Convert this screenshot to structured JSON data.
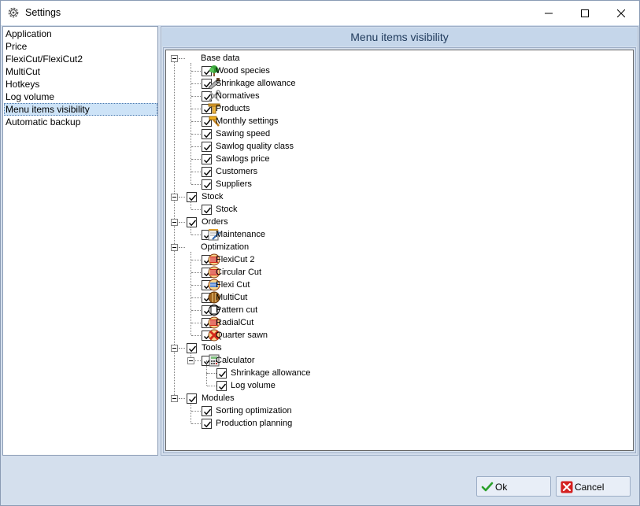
{
  "window": {
    "title": "Settings"
  },
  "nav": {
    "items": [
      {
        "label": "Application",
        "selected": false
      },
      {
        "label": "Price",
        "selected": false
      },
      {
        "label": "FlexiCut/FlexiCut2",
        "selected": false
      },
      {
        "label": "MultiCut",
        "selected": false
      },
      {
        "label": "Hotkeys",
        "selected": false
      },
      {
        "label": "Log volume",
        "selected": false
      },
      {
        "label": "Menu items visibility",
        "selected": true
      },
      {
        "label": "Automatic backup",
        "selected": false
      }
    ]
  },
  "panel": {
    "title": "Menu items visibility",
    "tree": [
      {
        "label": "Base data",
        "level": 0,
        "checkbox": false,
        "expandable": true,
        "icon": ""
      },
      {
        "label": "Wood species",
        "level": 1,
        "checkbox": true,
        "checked": true,
        "icon": "tree-icon"
      },
      {
        "label": "Shrinkage allowance",
        "level": 1,
        "checkbox": true,
        "checked": true,
        "icon": "saw-icon"
      },
      {
        "label": "Normatives",
        "level": 1,
        "checkbox": true,
        "checked": true,
        "icon": "tools-icon"
      },
      {
        "label": "Products",
        "level": 1,
        "checkbox": true,
        "checked": true,
        "icon": "beam-icon"
      },
      {
        "label": "Monthly settings",
        "level": 1,
        "checkbox": true,
        "checked": true,
        "icon": "hammer-icon"
      },
      {
        "label": "Sawing speed",
        "level": 1,
        "checkbox": true,
        "checked": true,
        "icon": ""
      },
      {
        "label": "Sawlog quality class",
        "level": 1,
        "checkbox": true,
        "checked": true,
        "icon": ""
      },
      {
        "label": "Sawlogs price",
        "level": 1,
        "checkbox": true,
        "checked": true,
        "icon": ""
      },
      {
        "label": "Customers",
        "level": 1,
        "checkbox": true,
        "checked": true,
        "icon": ""
      },
      {
        "label": "Suppliers",
        "level": 1,
        "checkbox": true,
        "checked": true,
        "icon": ""
      },
      {
        "label": "Stock",
        "level": 0,
        "checkbox": true,
        "checked": true,
        "expandable": true,
        "icon": ""
      },
      {
        "label": "Stock",
        "level": 1,
        "checkbox": true,
        "checked": true,
        "icon": ""
      },
      {
        "label": "Orders",
        "level": 0,
        "checkbox": true,
        "checked": true,
        "expandable": true,
        "icon": ""
      },
      {
        "label": "Maintenance",
        "level": 1,
        "checkbox": true,
        "checked": true,
        "icon": "maintenance-icon"
      },
      {
        "label": "Optimization",
        "level": 0,
        "checkbox": false,
        "expandable": true,
        "icon": ""
      },
      {
        "label": "FlexiCut 2",
        "level": 1,
        "checkbox": true,
        "checked": true,
        "icon": "log-red-icon"
      },
      {
        "label": "Circular Cut",
        "level": 1,
        "checkbox": true,
        "checked": true,
        "icon": "log-red-icon"
      },
      {
        "label": "Flexi Cut",
        "level": 1,
        "checkbox": true,
        "checked": true,
        "icon": "log-blue-icon"
      },
      {
        "label": "MultiCut",
        "level": 1,
        "checkbox": true,
        "checked": true,
        "icon": "log-brown-icon"
      },
      {
        "label": "Pattern cut",
        "level": 1,
        "checkbox": true,
        "checked": true,
        "icon": "log-outline-icon"
      },
      {
        "label": "RadialCut",
        "level": 1,
        "checkbox": true,
        "checked": true,
        "icon": "log-red-icon"
      },
      {
        "label": "Quarter sawn",
        "level": 1,
        "checkbox": true,
        "checked": true,
        "icon": "log-cross-icon"
      },
      {
        "label": "Tools",
        "level": 0,
        "checkbox": true,
        "checked": true,
        "expandable": true,
        "icon": ""
      },
      {
        "label": "Calculator",
        "level": 1,
        "checkbox": true,
        "checked": true,
        "expandable": true,
        "icon": "calculator-icon"
      },
      {
        "label": "Shrinkage allowance",
        "level": 2,
        "checkbox": true,
        "checked": true,
        "icon": ""
      },
      {
        "label": "Log volume",
        "level": 2,
        "checkbox": true,
        "checked": true,
        "icon": ""
      },
      {
        "label": "Modules",
        "level": 0,
        "checkbox": true,
        "checked": true,
        "expandable": true,
        "icon": ""
      },
      {
        "label": "Sorting optimization",
        "level": 1,
        "checkbox": true,
        "checked": true,
        "icon": ""
      },
      {
        "label": "Production planning",
        "level": 1,
        "checkbox": true,
        "checked": true,
        "icon": ""
      }
    ]
  },
  "buttons": {
    "ok": "Ok",
    "cancel": "Cancel"
  },
  "colors": {
    "accent": "#cde3f7",
    "frame": "#d4dfed",
    "header": "#c5d6ea",
    "ok": "#2aa02a",
    "cancel": "#d42020"
  }
}
